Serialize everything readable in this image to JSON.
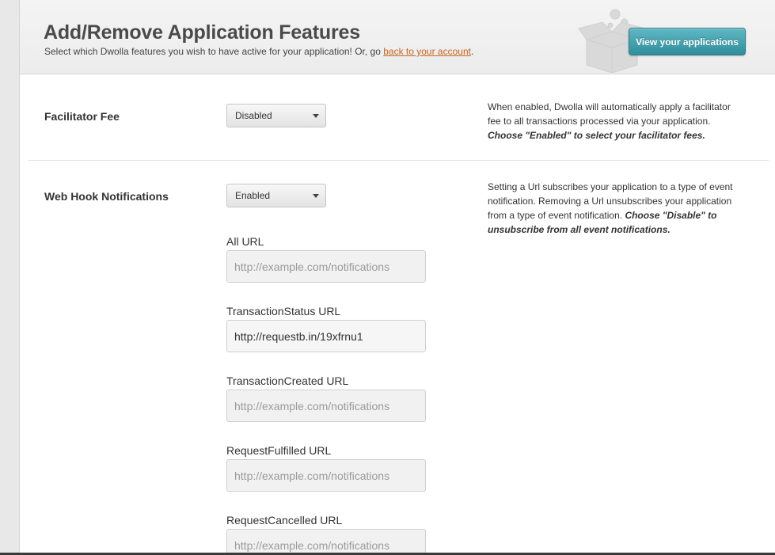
{
  "header": {
    "title": "Add/Remove Application Features",
    "subtitle_text": "Select which Dwolla features you wish to have active for your application! Or, go ",
    "subtitle_link": "back to your account",
    "subtitle_end": ".",
    "view_apps_label": "View your applications"
  },
  "facilitator": {
    "label": "Facilitator Fee",
    "select_value": "Disabled",
    "desc_text": "When enabled, Dwolla will automatically apply a facilitator fee to all transactions processed via your application. ",
    "desc_emphasis": "Choose \"Enabled\" to select your facilitator fees."
  },
  "webhook": {
    "label": "Web Hook Notifications",
    "select_value": "Enabled",
    "desc_text": "Setting a Url subscribes your application to a type of event notification. Removing a Url unsubscribes your application from a type of event notification. ",
    "desc_emphasis": "Choose \"Disable\" to unsubscribe from all event notifications.",
    "fields": [
      {
        "label": "All URL",
        "value": "",
        "placeholder": "http://example.com/notifications"
      },
      {
        "label": "TransactionStatus URL",
        "value": "http://requestb.in/19xfrnu1",
        "placeholder": "http://example.com/notifications"
      },
      {
        "label": "TransactionCreated URL",
        "value": "",
        "placeholder": "http://example.com/notifications"
      },
      {
        "label": "RequestFulfilled URL",
        "value": "",
        "placeholder": "http://example.com/notifications"
      },
      {
        "label": "RequestCancelled URL",
        "value": "",
        "placeholder": "http://example.com/notifications"
      }
    ]
  },
  "icons": {
    "header_art": "open-box-with-gears-icon",
    "select_caret": "caret-down-icon"
  },
  "colors": {
    "accent_button": "#3c9ba8",
    "link": "#c8641c"
  }
}
